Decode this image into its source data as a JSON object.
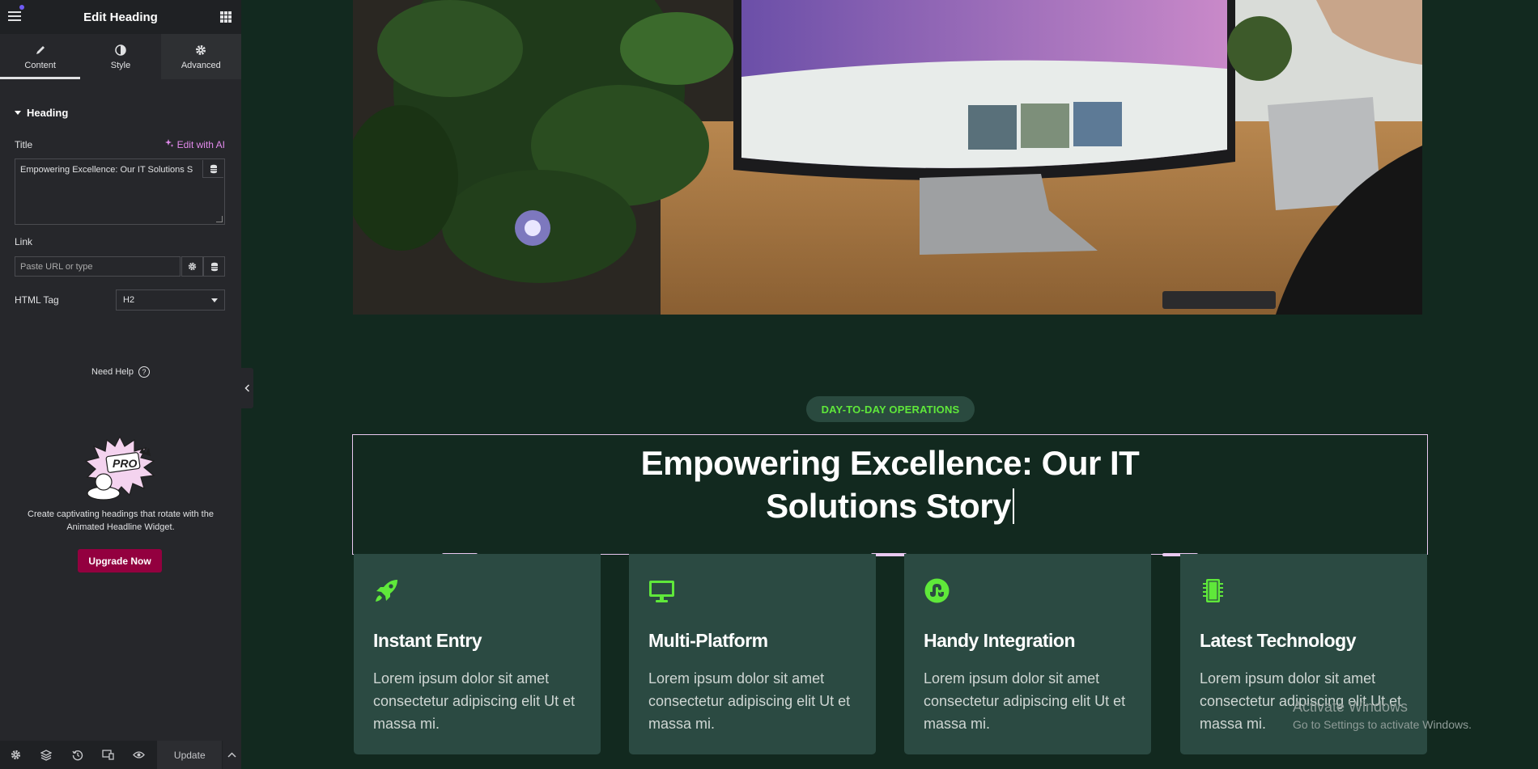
{
  "sidebar": {
    "header_title": "Edit Heading",
    "tabs": [
      {
        "label": "Content",
        "icon": "pencil-icon"
      },
      {
        "label": "Style",
        "icon": "contrast-icon"
      },
      {
        "label": "Advanced",
        "icon": "gear-icon"
      }
    ],
    "section_title": "Heading",
    "title_label": "Title",
    "edit_ai_label": "Edit with AI",
    "title_value": "Empowering Excellence: Our IT Solutions S",
    "link_label": "Link",
    "link_placeholder": "Paste URL or type",
    "html_tag_label": "HTML Tag",
    "html_tag_value": "H2",
    "need_help": "Need Help",
    "promo_text": "Create captivating headings that rotate with the Animated Headline Widget.",
    "pro_badge": "PRO",
    "upgrade_label": "Upgrade Now",
    "footer_update": "Update",
    "accent_color": "#93003f",
    "ai_color": "#e28aec"
  },
  "canvas": {
    "badge": "DAY-TO-DAY OPERATIONS",
    "heading_line1": "Empowering Excellence: Our IT",
    "heading_line2": "Solutions Story",
    "accent_color": "#5fe83a",
    "background": "#12291f",
    "cards": [
      {
        "icon": "rocket-icon",
        "title": "Instant Entry",
        "body": "Lorem ipsum dolor sit amet consectetur adipiscing elit Ut et massa mi."
      },
      {
        "icon": "monitor-icon",
        "title": "Multi-Platform",
        "body": "Lorem ipsum dolor sit amet consectetur adipiscing elit Ut et massa mi."
      },
      {
        "icon": "stumbleupon-icon",
        "title": "Handy Integration",
        "body": "Lorem ipsum dolor sit amet consectetur adipiscing elit Ut et massa mi."
      },
      {
        "icon": "chip-icon",
        "title": "Latest Technology",
        "body": "Lorem ipsum dolor sit amet consectetur adipiscing elit Ut et massa mi."
      }
    ]
  },
  "watermark": {
    "title": "Activate Windows",
    "subtitle": "Go to Settings to activate Windows."
  }
}
